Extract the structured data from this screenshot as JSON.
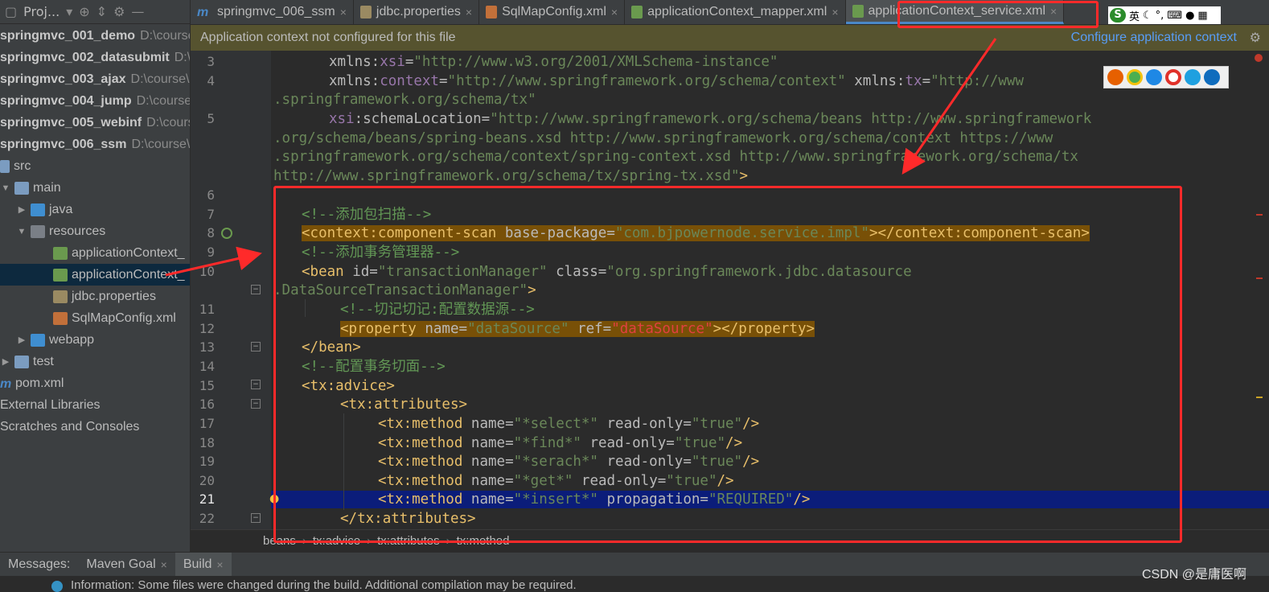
{
  "project_header": {
    "label": "Proj..."
  },
  "tree": [
    {
      "name": "springmvc_001_demo",
      "path": "D:\\course",
      "bold": true
    },
    {
      "name": "springmvc_002_datasubmit",
      "path": "D:\\c",
      "bold": true
    },
    {
      "name": "springmvc_003_ajax",
      "path": "D:\\course\\1",
      "bold": true
    },
    {
      "name": "springmvc_004_jump",
      "path": "D:\\course\\",
      "bold": true
    },
    {
      "name": "springmvc_005_webinf",
      "path": "D:\\cours",
      "bold": true
    },
    {
      "name": "springmvc_006_ssm",
      "path": "D:\\course\\1",
      "bold": true
    },
    {
      "name": "src"
    },
    {
      "name": "main"
    },
    {
      "name": "java"
    },
    {
      "name": "resources"
    },
    {
      "name": "applicationContext_"
    },
    {
      "name": "applicationContext_"
    },
    {
      "name": "jdbc.properties"
    },
    {
      "name": "SqlMapConfig.xml"
    },
    {
      "name": "webapp"
    },
    {
      "name": "test"
    },
    {
      "name": "pom.xml"
    },
    {
      "name": "External Libraries"
    },
    {
      "name": "Scratches and Consoles"
    }
  ],
  "tabs": [
    {
      "label": "springmvc_006_ssm",
      "close": "×"
    },
    {
      "label": "jdbc.properties",
      "close": "×"
    },
    {
      "label": "SqlMapConfig.xml",
      "close": "×"
    },
    {
      "label": "applicationContext_mapper.xml",
      "close": "×"
    },
    {
      "label": "applicationContext_service.xml",
      "close": "×"
    }
  ],
  "tray": {
    "text": "英"
  },
  "notification": {
    "message": "Application context not configured for this file",
    "link": "Configure application context"
  },
  "gutter": {
    "lines": [
      "3",
      "4",
      "",
      "5",
      "",
      "",
      "",
      "6",
      "7",
      "8",
      "9",
      "10",
      "",
      "11",
      "12",
      "13",
      "14",
      "15",
      "16",
      "17",
      "18",
      "19",
      "20",
      "21",
      "22"
    ]
  },
  "code": {
    "l3a": "xmlns:",
    "l3b": "xsi",
    "l3c": "=",
    "l3d": "\"http://www.w3.org/2001/XMLSchema-instance\"",
    "l4a": "xmlns:",
    "l4b": "context",
    "l4c": "=",
    "l4d": "\"http://www.springframework.org/schema/context\"",
    "l4e": " xmlns:",
    "l4f": "tx",
    "l4g": "=",
    "l4h": "\"http://www",
    "l4w": ".springframework.org/schema/tx\"",
    "l5a": "xsi",
    "l5b": ":schemaLocation=",
    "l5c": "\"http://www.springframework.org/schema/beans http://www.springframework",
    "l5w1": ".org/schema/beans/spring-beans.xsd http://www.springframework.org/schema/context https://www",
    "l5w2": ".springframework.org/schema/context/spring-context.xsd http://www.springframework.org/schema/tx",
    "l5w3": "http://www.springframework.org/schema/tx/spring-tx.xsd\"",
    "l5w3end": ">",
    "l7": "<!--添加包扫描-->",
    "l8a": "<context",
    "l8b": ":component-scan ",
    "l8c": "base-package",
    "l8d": "=",
    "l8e": "\"com.bjpowernode.service.impl\"",
    "l8f": "></context",
    "l8g": ":component-scan>",
    "l9": "<!--添加事务管理器-->",
    "l10a": "<bean ",
    "l10b": "id",
    "l10c": "=",
    "l10d": "\"transactionManager\"",
    "l10e": " class",
    "l10f": "=",
    "l10g": "\"org.springframework.jdbc.datasource",
    "l10w": ".DataSourceTransactionManager\"",
    "l10wend": ">",
    "l11": "<!--切记切记:配置数据源-->",
    "l12a": "<property ",
    "l12b": "name",
    "l12c": "=",
    "l12d": "\"dataSource\"",
    "l12e": " ref",
    "l12f": "=",
    "l12g": "\"dataSource\"",
    "l12h": "></property>",
    "l13": "</bean>",
    "l14": "<!--配置事务切面-->",
    "l15a": "<tx",
    "l15b": ":advice>",
    "l16a": "<tx",
    "l16b": ":attributes>",
    "m17n": "\"*select*\"",
    "m17k": " read-only",
    "m17v": "\"true\"",
    "m18n": "\"*find*\"",
    "m18k": " read-only",
    "m18v": "\"true\"",
    "m19n": "\"*serach*\"",
    "m19k": " read-only",
    "m19v": "\"true\"",
    "m20n": "\"*get*\"",
    "m20k": " read-only",
    "m20v": "\"true\"",
    "m21n": "\"*insert*\"",
    "m21k": " propagation",
    "m21v": "\"REQUIRED\"",
    "mopen": "<tx",
    "mtag": ":method ",
    "mname": "name",
    "meq": "=",
    "mclose": "/>",
    "l22a": "</tx",
    "l22b": ":attributes>"
  },
  "breadcrumb": [
    "beans",
    "tx:advice",
    "tx:attributes",
    "tx:method"
  ],
  "bottom_tabs": [
    {
      "label": "Messages:"
    },
    {
      "label": "Maven Goal",
      "close": "×"
    },
    {
      "label": "Build",
      "close": "×"
    }
  ],
  "info": {
    "text": "Information: Some files were changed during the build. Additional compilation may be required."
  },
  "watermark": "CSDN @是庸医啊",
  "colors": {
    "annotation": "#ff2a2a",
    "current_line": "#0b1d7a",
    "highlight": "#785007",
    "link": "#589df6"
  }
}
